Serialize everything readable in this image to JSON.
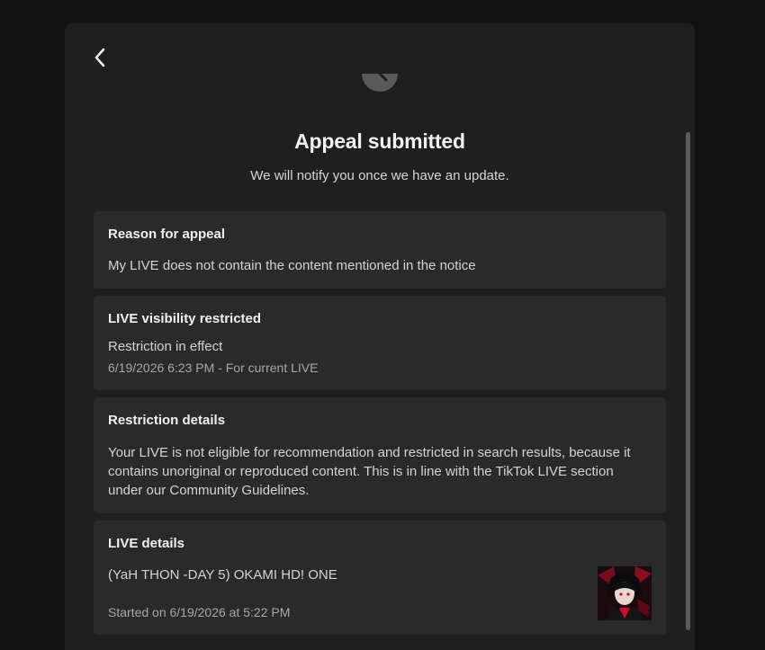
{
  "header": {
    "back_icon": "chevron-left-icon",
    "status_icon": "clock-icon",
    "title": "Appeal submitted",
    "subtitle": "We will notify you once we have an update."
  },
  "cards": {
    "reason": {
      "title": "Reason for appeal",
      "text": "My LIVE does not contain the content mentioned in the notice"
    },
    "visibility": {
      "title": "LIVE visibility restricted",
      "status": "Restriction in effect",
      "meta": "6/19/2026 6:23 PM - For current LIVE"
    },
    "details": {
      "title": "Restriction details",
      "text": "Your LIVE is not eligible for recommendation and restricted in search results, because it contains unoriginal or reproduced content. This is in line with the TikTok LIVE section under our Community Guidelines."
    },
    "live": {
      "title": "LIVE details",
      "name": "(YaH THON -DAY 5) OKAMI HD! ONE",
      "started": "Started on 6/19/2026 at 5:22 PM",
      "thumbnail_icon": "live-thumbnail-image"
    }
  },
  "colors": {
    "page_bg": "#121212",
    "panel_bg": "#1f1f1f",
    "card_bg": "#2a2a2a",
    "accent_red": "#c8102e"
  }
}
